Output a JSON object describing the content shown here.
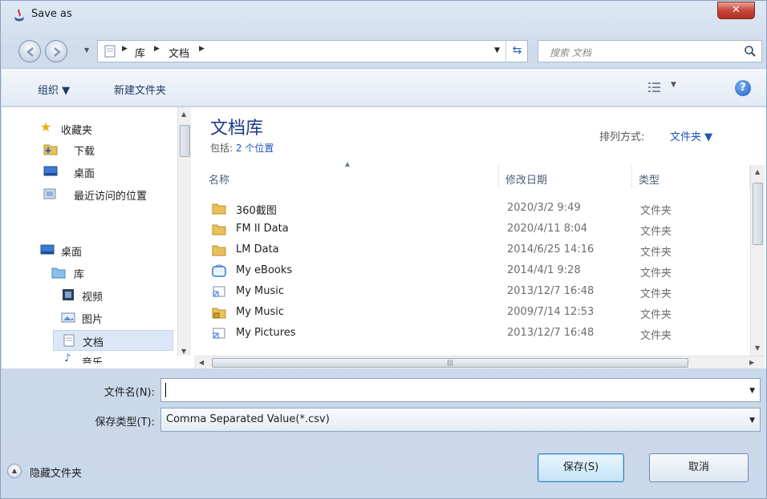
{
  "window": {
    "title": "Save as"
  },
  "address": {
    "crumbs": [
      "库",
      "文档"
    ],
    "search_placeholder": "搜索 文档"
  },
  "toolbar": {
    "organize": "组织 ▼",
    "new_folder": "新建文件夹",
    "help": "?"
  },
  "nav": {
    "items": [
      {
        "label": "收藏夹",
        "icon": "star-icon"
      },
      {
        "label": "下载",
        "icon": "download-folder-icon"
      },
      {
        "label": "桌面",
        "icon": "desktop-icon"
      },
      {
        "label": "最近访问的位置",
        "icon": "recent-places-icon"
      },
      {
        "label": "桌面",
        "icon": "desktop-icon"
      },
      {
        "label": "库",
        "icon": "library-icon"
      },
      {
        "label": "视频",
        "icon": "video-library-icon"
      },
      {
        "label": "图片",
        "icon": "pictures-library-icon"
      },
      {
        "label": "文档",
        "icon": "documents-library-icon"
      },
      {
        "label": "音乐",
        "icon": "music-library-icon"
      }
    ]
  },
  "library": {
    "title": "文档库",
    "includes_label": "包括:",
    "includes_link": "2 个位置",
    "sort_label": "排列方式:",
    "sort_value": "文件夹 ▼"
  },
  "columns": {
    "name": "名称",
    "date": "修改日期",
    "type": "类型"
  },
  "files": [
    {
      "name": "360截图",
      "date": "2020/3/2 9:49",
      "type": "文件夹",
      "icon": "folder-icon"
    },
    {
      "name": "FM II Data",
      "date": "2020/4/11 8:04",
      "type": "文件夹",
      "icon": "folder-icon"
    },
    {
      "name": "LM Data",
      "date": "2014/6/25 14:16",
      "type": "文件夹",
      "icon": "folder-icon"
    },
    {
      "name": "My eBooks",
      "date": "2014/4/1 9:28",
      "type": "文件夹",
      "icon": "ebooks-folder-icon"
    },
    {
      "name": "My Music",
      "date": "2013/12/7 16:48",
      "type": "文件夹",
      "icon": "shortcut-icon"
    },
    {
      "name": "My Music",
      "date": "2009/7/14 12:53",
      "type": "文件夹",
      "icon": "locked-folder-icon"
    },
    {
      "name": "My Pictures",
      "date": "2013/12/7 16:48",
      "type": "文件夹",
      "icon": "shortcut-icon"
    }
  ],
  "form": {
    "filename_label": "文件名(N):",
    "filename_value": "",
    "filetype_label": "保存类型(T):",
    "filetype_value": "Comma Separated Value(*.csv)"
  },
  "buttons": {
    "hide_folders": "隐藏文件夹",
    "save": "保存(S)",
    "cancel": "取消"
  },
  "colors": {
    "accent": "#1d56b8",
    "selected": "#dbe7f6",
    "close": "#c7463a"
  }
}
